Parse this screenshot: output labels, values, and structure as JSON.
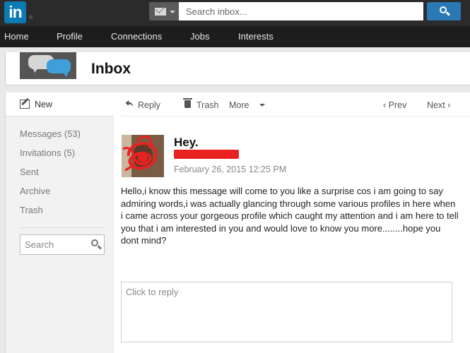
{
  "topbar": {
    "logo_text": "in",
    "logo_mark": "®",
    "search_placeholder": "Search inbox...",
    "search_category_icon": "mail-icon",
    "search_button_icon": "search-icon"
  },
  "nav": {
    "items": [
      "Home",
      "Profile",
      "Connections",
      "Jobs",
      "Interests"
    ]
  },
  "header": {
    "title": "Inbox",
    "icon": "chat-bubbles-icon"
  },
  "sidebar": {
    "new_label": "New",
    "items": [
      "Messages (53)",
      "Invitations (5)",
      "Sent",
      "Archive",
      "Trash"
    ],
    "search_placeholder": "Search"
  },
  "toolbar": {
    "reply": "Reply",
    "trash": "Trash",
    "more": "More",
    "prev": "‹ Prev",
    "next": "Next ›"
  },
  "message": {
    "subject": "Hey.",
    "date": "February 26, 2015 12:25 PM",
    "body": "Hello,i know this message will come to you like a surprise cos i am going to say admiring words,i was actually glancing through some various profiles in here when i came across your gorgeous profile which caught my attention and i am here to tell you that i am interested in you and would love to know you more........hope you dont mind?",
    "reply_placeholder": "Click to reply"
  },
  "colors": {
    "brand_blue": "#0c7bb3",
    "search_button": "#2a78b4",
    "redaction_red": "#e82121"
  }
}
